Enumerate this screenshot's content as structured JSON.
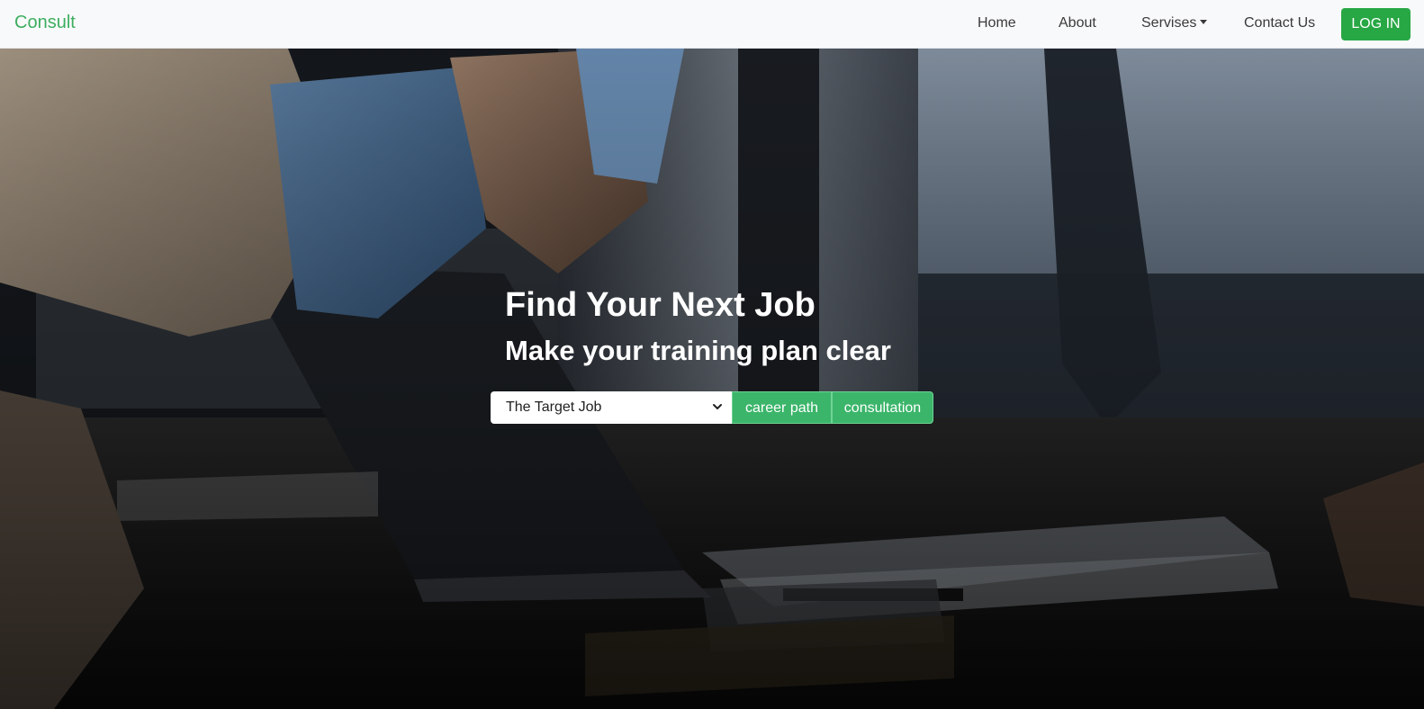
{
  "navbar": {
    "brand": "Consult",
    "links": [
      {
        "label": "Home"
      },
      {
        "label": "About"
      },
      {
        "label": "Servises"
      },
      {
        "label": "Contact Us"
      }
    ],
    "login_label": "LOG IN"
  },
  "hero": {
    "title": "Find Your Next Job",
    "subtitle": "Make your training plan clear",
    "select": {
      "value": "The Target Job"
    },
    "buttons": {
      "career_path": "career path",
      "consultation": "consultation"
    }
  },
  "colors": {
    "brand": "#3dae5f",
    "login_button": "#28a745",
    "group_button": "#3bb56a",
    "navbar_bg": "#f8f9fa"
  },
  "icons": {
    "dropdown_caret": "caret-down-icon",
    "select_chevron": "chevron-down-icon"
  }
}
